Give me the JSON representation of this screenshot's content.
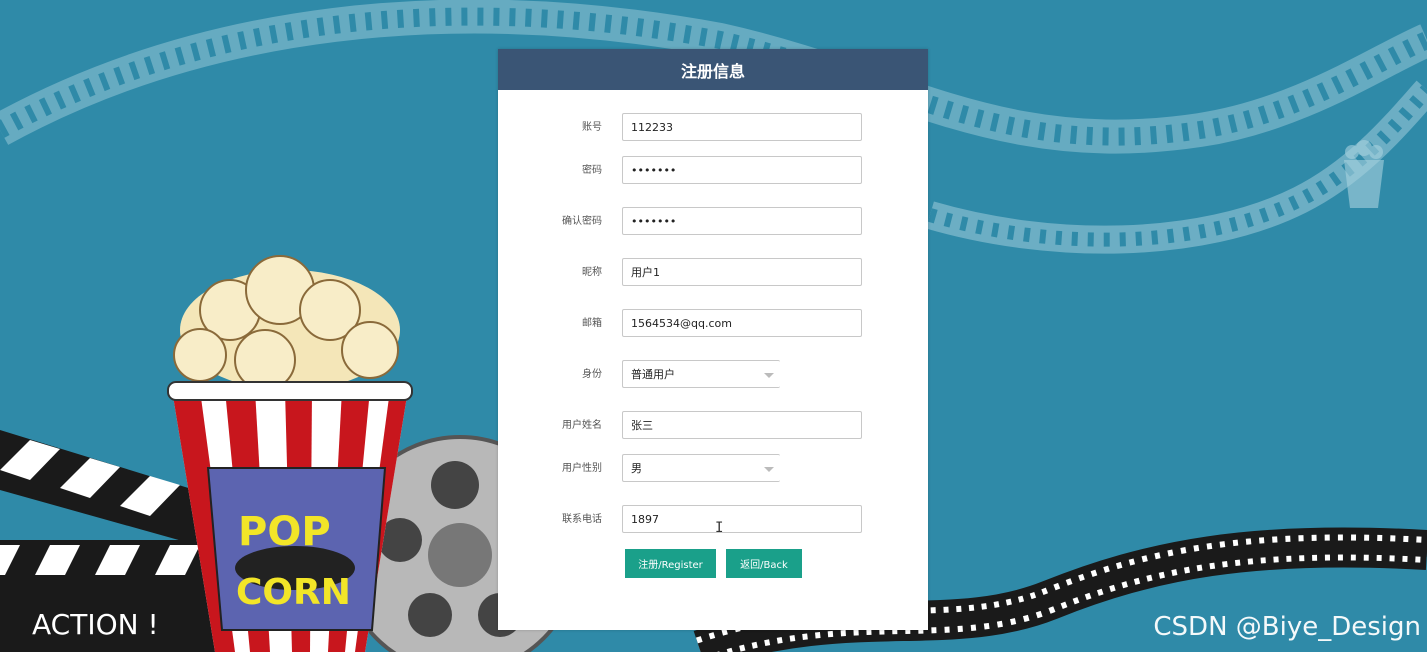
{
  "panel": {
    "title": "注册信息",
    "header_color": "#3a5575"
  },
  "form": {
    "account_label": "账号",
    "account_value": "112233",
    "password_label": "密码",
    "password_value": "•••••••",
    "confirm_password_label": "确认密码",
    "confirm_password_value": "•••••••",
    "nickname_label": "昵称",
    "nickname_value": "用户1",
    "email_label": "邮箱",
    "email_value": "1564534@qq.com",
    "role_label": "身份",
    "role_value": "普通用户",
    "name_label": "用户姓名",
    "name_value": "张三",
    "gender_label": "用户性别",
    "gender_value": "男",
    "phone_label": "联系电话",
    "phone_value": "1897"
  },
  "buttons": {
    "register_label": "注册/Register",
    "back_label": "返回/Back",
    "color": "#1aa08a"
  },
  "background": {
    "color": "#2f8aa8",
    "popcorn_text_1": "POP",
    "popcorn_text_2": "CORN",
    "clapper_text": "ACTION !"
  },
  "watermark": "CSDN @Biye_Design"
}
